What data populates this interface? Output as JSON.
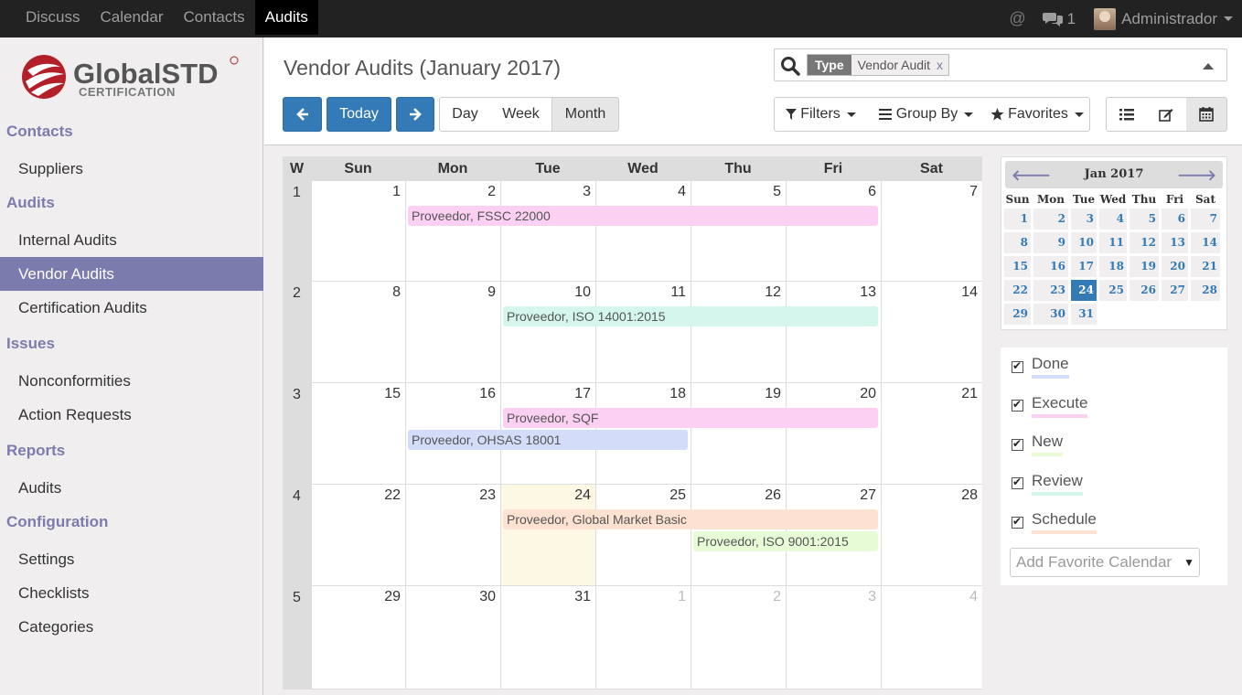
{
  "topnav": {
    "items": [
      "Discuss",
      "Calendar",
      "Contacts",
      "Audits"
    ],
    "active_index": 3,
    "at_symbol": "@",
    "message_count": "1",
    "user": "Administrador"
  },
  "logo": {
    "brand": "GlobalSTD",
    "sub": "CERTIFICATION"
  },
  "sidebar": {
    "contacts": "Contacts",
    "suppliers": "Suppliers",
    "audits": "Audits",
    "internal_audits": "Internal Audits",
    "vendor_audits": "Vendor Audits",
    "certification_audits": "Certification Audits",
    "issues": "Issues",
    "nonconformities": "Nonconformities",
    "action_requests": "Action Requests",
    "reports": "Reports",
    "reports_audits": "Audits",
    "configuration": "Configuration",
    "settings": "Settings",
    "checklists": "Checklists",
    "categories": "Categories"
  },
  "header": {
    "title": "Vendor Audits (January 2017)",
    "facet_type": "Type",
    "facet_value": "Vendor Audit",
    "facet_remove": "x",
    "today": "Today",
    "day": "Day",
    "week": "Week",
    "month": "Month",
    "filters": "Filters",
    "group_by": "Group By",
    "favorites": "Favorites"
  },
  "calendar": {
    "week_header": "W",
    "days": [
      "Sun",
      "Mon",
      "Tue",
      "Wed",
      "Thu",
      "Fri",
      "Sat"
    ],
    "weeks": [
      {
        "num": "1",
        "dates": [
          "1",
          "2",
          "3",
          "4",
          "5",
          "6",
          "7"
        ]
      },
      {
        "num": "2",
        "dates": [
          "8",
          "9",
          "10",
          "11",
          "12",
          "13",
          "14"
        ]
      },
      {
        "num": "3",
        "dates": [
          "15",
          "16",
          "17",
          "18",
          "19",
          "20",
          "21"
        ]
      },
      {
        "num": "4",
        "dates": [
          "22",
          "23",
          "24",
          "25",
          "26",
          "27",
          "28"
        ]
      },
      {
        "num": "5",
        "dates": [
          "29",
          "30",
          "31",
          "1",
          "2",
          "3",
          "4"
        ]
      }
    ],
    "today": {
      "week": 3,
      "day": 2
    },
    "events": [
      {
        "title": "Proveedor, FSSC 22000",
        "week": 0,
        "start": 1,
        "end": 5,
        "lane": 0,
        "color": "#fbd0f2"
      },
      {
        "title": "Proveedor, ISO 14001:2015",
        "week": 1,
        "start": 2,
        "end": 5,
        "lane": 0,
        "color": "#d4f6ec"
      },
      {
        "title": "Proveedor, SQF",
        "week": 2,
        "start": 2,
        "end": 5,
        "lane": 0,
        "color": "#fbd0f2"
      },
      {
        "title": "Proveedor, OHSAS 18001",
        "week": 2,
        "start": 1,
        "end": 3,
        "lane": 1,
        "color": "#d3dcf9"
      },
      {
        "title": "Proveedor, Global Market Basic",
        "week": 3,
        "start": 2,
        "end": 5,
        "lane": 0,
        "color": "#fde1d1"
      },
      {
        "title": "Proveedor, ISO 9001:2015",
        "week": 3,
        "start": 4,
        "end": 5,
        "lane": 1,
        "color": "#e7fbd7"
      }
    ]
  },
  "minical": {
    "title": "Jan 2017",
    "prev": "🡐",
    "next": "🡒",
    "dow": [
      "Sun",
      "Mon",
      "Tue",
      "Wed",
      "Thu",
      "Fri",
      "Sat"
    ],
    "rows": [
      [
        "",
        "",
        "",
        "",
        "",
        "",
        ""
      ],
      [
        "1",
        "2",
        "3",
        "4",
        "5",
        "6",
        "7"
      ],
      [
        "8",
        "9",
        "10",
        "11",
        "12",
        "13",
        "14"
      ],
      [
        "15",
        "16",
        "17",
        "18",
        "19",
        "20",
        "21"
      ],
      [
        "22",
        "23",
        "24",
        "25",
        "26",
        "27",
        "28"
      ],
      [
        "29",
        "30",
        "31",
        "",
        "",
        "",
        ""
      ]
    ],
    "selected": "24"
  },
  "legend": {
    "items": [
      {
        "label": "Done",
        "color": "#d3dcf9"
      },
      {
        "label": "Execute",
        "color": "#fbd0f2"
      },
      {
        "label": "New",
        "color": "#e7fbd7"
      },
      {
        "label": "Review",
        "color": "#d4f6ec"
      },
      {
        "label": "Schedule",
        "color": "#fde1d1"
      }
    ],
    "favorite_placeholder": "Add Favorite Calendar"
  }
}
